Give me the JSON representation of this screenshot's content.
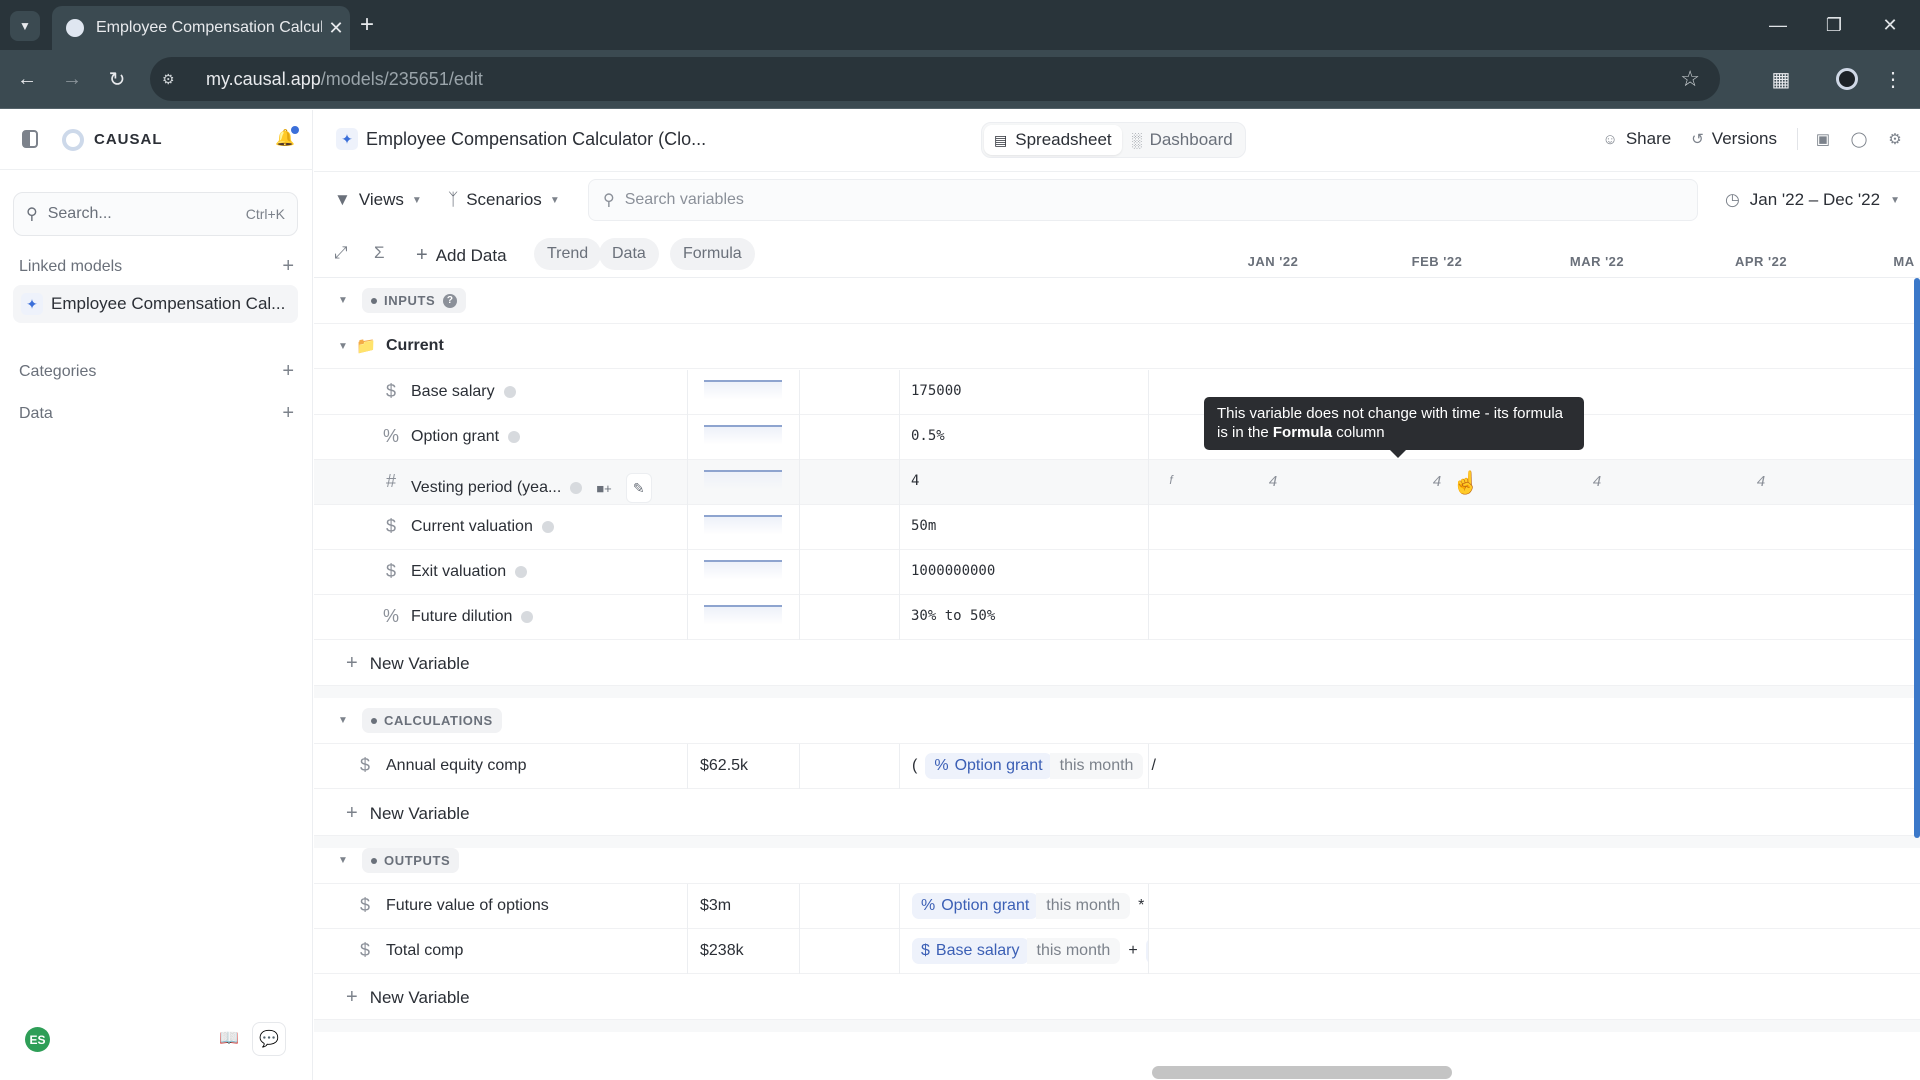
{
  "browser": {
    "tab_title": "Employee Compensation Calcul",
    "url_host": "my.causal.app",
    "url_path": "/models/235651/edit",
    "icons": {
      "dropdown": "chevron-down-icon",
      "close": "close-icon",
      "new_tab": "plus-icon",
      "back": "arrow-left-icon",
      "forward": "arrow-right-icon",
      "reload": "reload-icon",
      "site_info": "tune-icon",
      "bookmark": "star-icon",
      "extensions": "puzzle-icon",
      "profile": "profile-icon",
      "menu": "kebab-icon"
    }
  },
  "sidebar": {
    "brand": "CAUSAL",
    "search_placeholder": "Search...",
    "search_shortcut": "Ctrl+K",
    "sections": [
      {
        "label": "Linked models"
      },
      {
        "label": "Categories"
      },
      {
        "label": "Data"
      }
    ],
    "linked_model": "Employee Compensation Cal...",
    "avatar_initials": "ES",
    "avatar_color": "#2e9e57"
  },
  "header": {
    "model_title": "Employee Compensation Calculator (Clo...",
    "view_toggle": [
      {
        "label": "Spreadsheet",
        "active": true
      },
      {
        "label": "Dashboard",
        "active": false
      }
    ],
    "share_label": "Share",
    "versions_label": "Versions"
  },
  "toolbar": {
    "views_label": "Views",
    "scenarios_label": "Scenarios",
    "search_placeholder": "Search variables",
    "date_range": "Jan '22 – Dec '22"
  },
  "grid_toolbar": {
    "add_data_label": "Add Data",
    "pills": [
      "Trend",
      "Data",
      "Formula"
    ],
    "months": [
      "JAN '22",
      "FEB '22",
      "MAR '22",
      "APR '22",
      "MA"
    ]
  },
  "sections": {
    "inputs": {
      "label": "INPUTS",
      "group": "Current",
      "variables": [
        {
          "type": "$",
          "name": "Base salary",
          "formula": "175000"
        },
        {
          "type": "%",
          "name": "Option grant",
          "formula": "0.5%"
        },
        {
          "type": "#",
          "name": "Vesting period (yea...",
          "formula": "4",
          "time_values": [
            "4",
            "4",
            "4",
            "4"
          ]
        },
        {
          "type": "$",
          "name": "Current valuation",
          "formula": "50m"
        },
        {
          "type": "$",
          "name": "Exit valuation",
          "formula": "1000000000"
        },
        {
          "type": "%",
          "name": "Future dilution",
          "formula": "30% to 50%"
        }
      ],
      "new_variable": "New Variable"
    },
    "calculations": {
      "label": "CALCULATIONS",
      "variables": [
        {
          "type": "$",
          "name": "Annual equity comp",
          "summary": "$62.5k",
          "formula_prefix": "(",
          "token_type": "%",
          "token": "Option grant",
          "modifier": "this month",
          "op": "/"
        }
      ],
      "new_variable": "New Variable"
    },
    "outputs": {
      "label": "OUTPUTS",
      "variables": [
        {
          "type": "$",
          "name": "Future value of options",
          "summary": "$3m",
          "token_type": "%",
          "token": "Option grant",
          "modifier": "this month",
          "op": "*"
        },
        {
          "type": "$",
          "name": "Total comp",
          "summary": "$238k",
          "token_type": "$",
          "token": "Base salary",
          "modifier": "this month",
          "op": "+",
          "next_token_type": "$"
        }
      ],
      "new_variable": "New Variable"
    }
  },
  "tooltip": {
    "text_before": "This variable does not change with time - its formula is in the ",
    "bold": "Formula",
    "text_after": " column"
  }
}
